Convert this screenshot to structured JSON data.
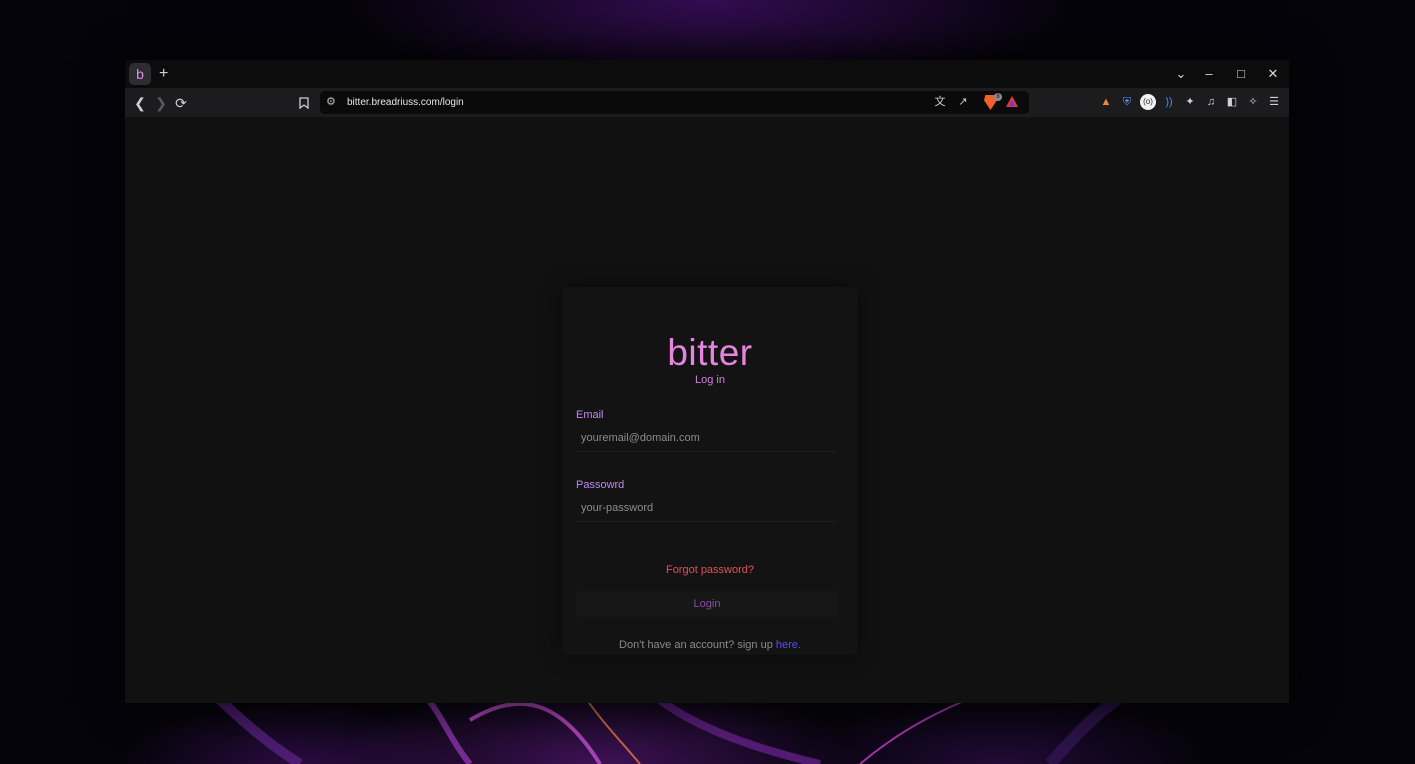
{
  "browser": {
    "tab_favicon_letter": "b",
    "new_tab_glyph": "+",
    "url": "bitter.breadriuss.com/login",
    "brave_shields_count": "8",
    "icons": {
      "back": "arrow-left-icon",
      "forward": "arrow-right-icon",
      "reload": "reload-icon",
      "bookmark": "bookmark-icon",
      "site_settings": "tune-icon",
      "translate": "translate-icon",
      "share": "share-icon",
      "extensions": [
        "metamask-icon",
        "bitwarden-icon",
        "circle-extension-icon",
        "wave-extension-icon",
        "puzzle-icon",
        "music-icon",
        "sidebar-icon",
        "leo-ai-icon",
        "menu-icon"
      ]
    }
  },
  "login": {
    "logo": "bitter",
    "subtitle": "Log in",
    "email_label": "Email",
    "email_placeholder": "youremail@domain.com",
    "password_label": "Passowrd",
    "password_placeholder": "your-password",
    "forgot": "Forgot password?",
    "button": "Login",
    "signup_text": "Don't have an account? sign up ",
    "signup_link": "here."
  },
  "colors": {
    "accent_pink": "#e685de",
    "label_purple": "#c088f0",
    "forgot_red": "#e0505a",
    "link_blue": "#5a4ee8"
  }
}
